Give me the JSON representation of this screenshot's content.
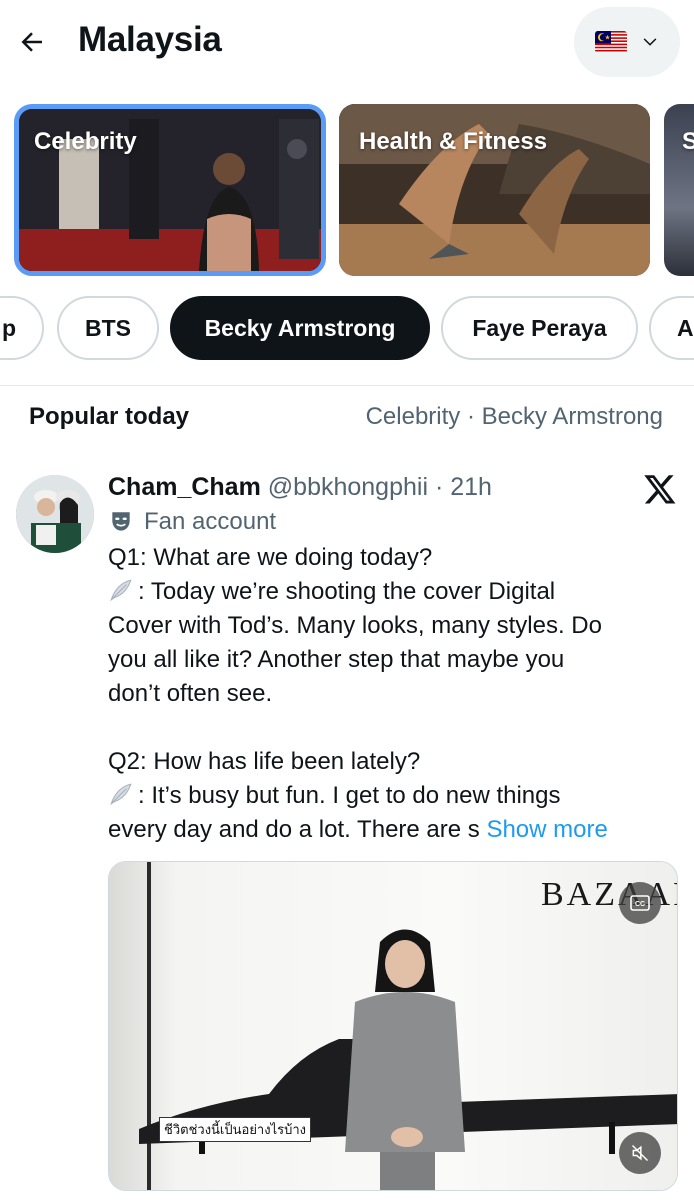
{
  "header": {
    "title": "Malaysia",
    "back_icon": "arrow-left-icon",
    "country_flag": "malaysia-flag-icon",
    "dropdown_icon": "chevron-down-icon"
  },
  "categories": [
    {
      "label": "Celebrity",
      "selected": true
    },
    {
      "label": "Health & Fitness",
      "selected": false
    },
    {
      "label": "S",
      "selected": false
    }
  ],
  "chips": [
    {
      "label": "p",
      "active": false
    },
    {
      "label": "BTS",
      "active": false
    },
    {
      "label": "Becky Armstrong",
      "active": true
    },
    {
      "label": "Faye Peraya",
      "active": false
    },
    {
      "label": "A",
      "active": false
    }
  ],
  "section": {
    "title": "Popular today",
    "context": "Celebrity · Becky Armstrong"
  },
  "tweet": {
    "display_name": "Cham_Cham",
    "handle": "@bbkhongphii",
    "separator": "·",
    "time": "21h",
    "account_label": "Fan account",
    "lines": [
      "Q1: What are we doing today?",
      ": Today we’re shooting the cover Digital",
      "Cover with Tod’s. Many looks, many styles. Do",
      "you all like it? Another step that maybe you",
      "don’t often see.",
      "",
      "Q2: How has life been lately?",
      ": It’s busy but fun. I get to do new things",
      "every day and do a lot. There are s"
    ],
    "show_more": "Show more",
    "media": {
      "watermark": "BAZAAR",
      "subtitle": "ชีวิตช่วงนี้เป็นอย่างไรบ้าง"
    }
  },
  "colors": {
    "accent": "#1d9bf0",
    "selected_border": "#5a9bf6",
    "text_primary": "#0f1419",
    "text_secondary": "#536471"
  }
}
